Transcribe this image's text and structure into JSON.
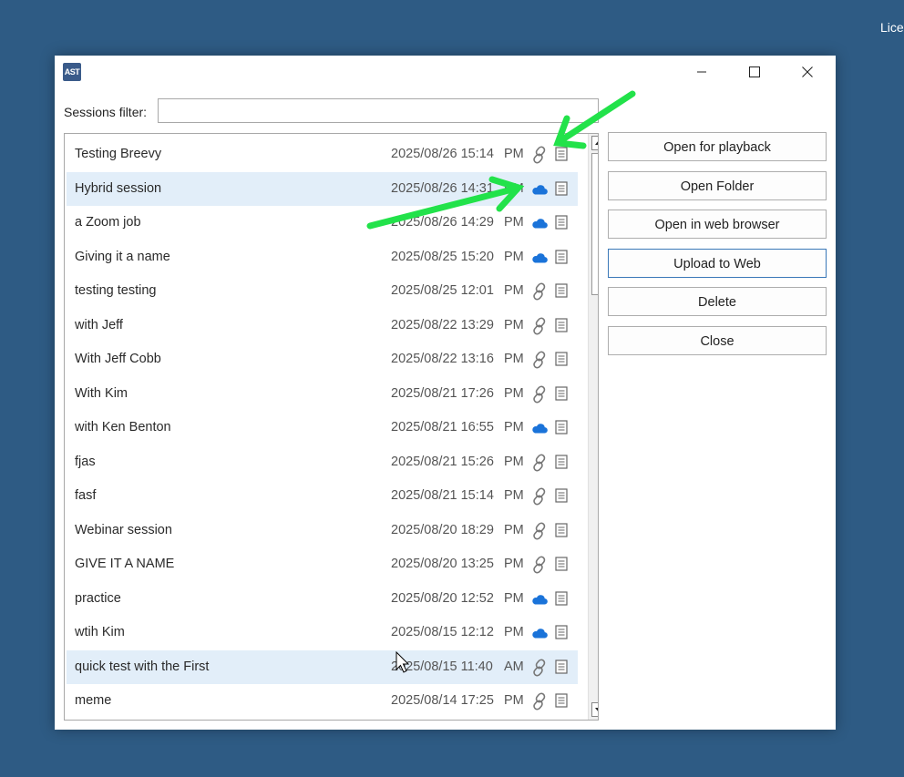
{
  "background": {
    "corner_text": "Lice"
  },
  "window": {
    "logo_text": "AST",
    "controls": [
      "minimize",
      "maximize",
      "close"
    ]
  },
  "filter": {
    "label": "Sessions filter:",
    "value": "",
    "placeholder": ""
  },
  "sessions": [
    {
      "name": "Testing Breevy",
      "date": "2025/08/26 15:14",
      "ampm": "PM",
      "status": "link",
      "selected": false
    },
    {
      "name": "Hybrid session",
      "date": "2025/08/26 14:31",
      "ampm": "PM",
      "status": "cloud",
      "selected": true
    },
    {
      "name": "a Zoom job",
      "date": "2025/08/26 14:29",
      "ampm": "PM",
      "status": "cloud",
      "selected": false
    },
    {
      "name": "Giving it a name",
      "date": "2025/08/25 15:20",
      "ampm": "PM",
      "status": "cloud",
      "selected": false
    },
    {
      "name": "testing testing",
      "date": "2025/08/25 12:01",
      "ampm": "PM",
      "status": "link",
      "selected": false
    },
    {
      "name": "with Jeff",
      "date": "2025/08/22 13:29",
      "ampm": "PM",
      "status": "link",
      "selected": false
    },
    {
      "name": "With Jeff Cobb",
      "date": "2025/08/22 13:16",
      "ampm": "PM",
      "status": "link",
      "selected": false
    },
    {
      "name": "With Kim",
      "date": "2025/08/21 17:26",
      "ampm": "PM",
      "status": "link",
      "selected": false
    },
    {
      "name": "with Ken Benton",
      "date": "2025/08/21 16:55",
      "ampm": "PM",
      "status": "cloud",
      "selected": false
    },
    {
      "name": "fjas",
      "date": "2025/08/21 15:26",
      "ampm": "PM",
      "status": "link",
      "selected": false
    },
    {
      "name": "fasf",
      "date": "2025/08/21 15:14",
      "ampm": "PM",
      "status": "link",
      "selected": false
    },
    {
      "name": "Webinar session",
      "date": "2025/08/20 18:29",
      "ampm": "PM",
      "status": "link",
      "selected": false
    },
    {
      "name": "GIVE IT A NAME",
      "date": "2025/08/20 13:25",
      "ampm": "PM",
      "status": "link",
      "selected": false
    },
    {
      "name": "practice",
      "date": "2025/08/20 12:52",
      "ampm": "PM",
      "status": "cloud",
      "selected": false
    },
    {
      "name": "wtih Kim",
      "date": "2025/08/15 12:12",
      "ampm": "PM",
      "status": "cloud",
      "selected": false
    },
    {
      "name": "quick test with the First",
      "date": "2025/08/15 11:40",
      "ampm": "AM",
      "status": "link",
      "selected": true
    },
    {
      "name": "meme",
      "date": "2025/08/14 17:25",
      "ampm": "PM",
      "status": "link",
      "selected": false
    }
  ],
  "actions": {
    "open_playback": "Open for playback",
    "open_folder": "Open Folder",
    "open_web": "Open in web browser",
    "upload_web": "Upload to Web",
    "delete": "Delete",
    "close": "Close"
  },
  "colors": {
    "desktop": "#2e5b84",
    "cloud": "#1a73d9",
    "selection": "#e2eef9",
    "annotation_arrow": "#22e24a"
  },
  "icons": {
    "link_status": "link-icon",
    "cloud_status": "cloud-icon",
    "notes": "document-icon"
  }
}
